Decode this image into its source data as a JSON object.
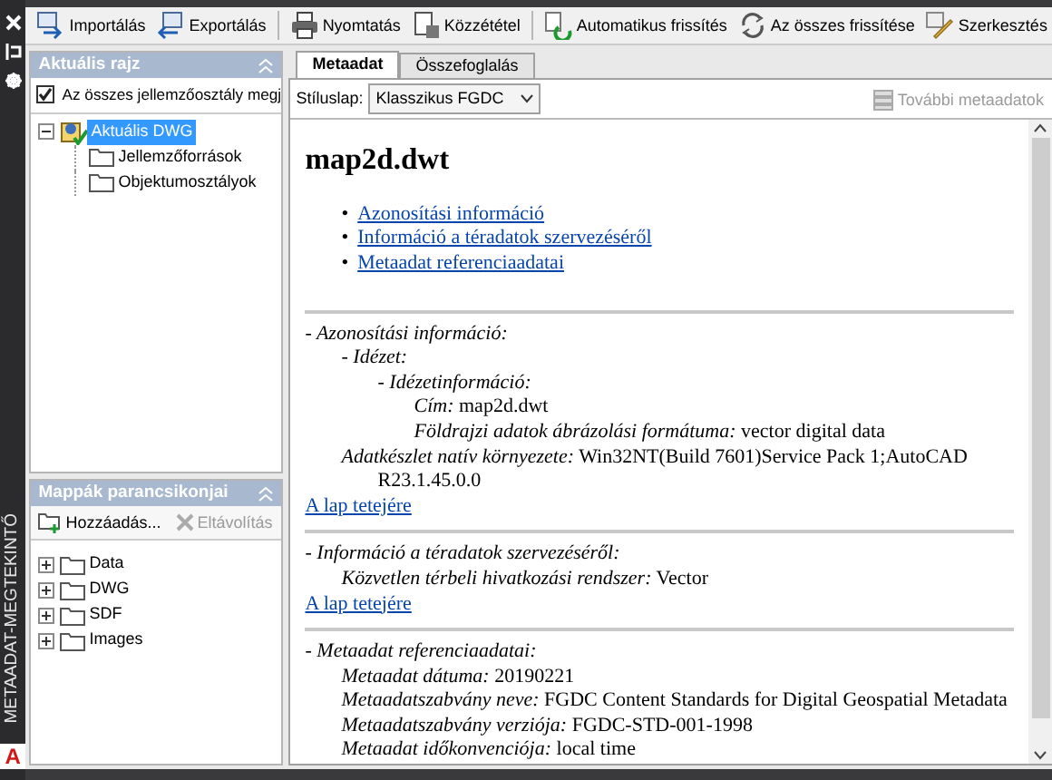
{
  "side_strip": {
    "title": "METAADAT-MEGTEKINTŐ",
    "logo": "A"
  },
  "toolbar": [
    [
      {
        "label": "Importálás"
      },
      {
        "label": "Exportálás"
      }
    ],
    [
      {
        "label": "Nyomtatás"
      },
      {
        "label": "Közzététel"
      }
    ],
    [
      {
        "label": "Automatikus frissítés"
      },
      {
        "label": "Az összes frissítése"
      },
      {
        "label": "Szerkesztés"
      }
    ]
  ],
  "drawing_panel": {
    "title": "Aktuális rajz",
    "checkbox": {
      "label": "Az összes jellemzőosztály megj",
      "checked": true
    },
    "tree": [
      {
        "label": "Aktuális DWG",
        "expanded": true,
        "selected": true,
        "children": [
          {
            "label": "Jellemzőforrások",
            "selected": false
          },
          {
            "label": "Objektumosztályok",
            "selected": false
          }
        ]
      }
    ]
  },
  "folders_panel": {
    "title": "Mappák parancsikonjai",
    "actions": [
      {
        "label": "Hozzáadás...",
        "disabled": false
      },
      {
        "label": "Eltávolítás",
        "disabled": true
      }
    ],
    "tree": [
      {
        "label": "Data",
        "expanded": false,
        "selected": false
      },
      {
        "label": "DWG",
        "expanded": false,
        "selected": false
      },
      {
        "label": "SDF",
        "expanded": false,
        "selected": false
      },
      {
        "label": "Images",
        "expanded": false,
        "selected": false
      }
    ]
  },
  "tabs": [
    {
      "label": "Metaadat",
      "selected": true
    },
    {
      "label": "Összefoglalás",
      "selected": false
    }
  ],
  "stylesheet": {
    "label": "Stíluslap:",
    "value": "Klasszikus FGDC"
  },
  "more_metadata": {
    "label": "További metaadatok",
    "disabled": true
  },
  "document": {
    "title": "map2d.dwt",
    "toc": [
      {
        "bullet": "•",
        "label": "Azonosítási információ"
      },
      {
        "bullet": "•",
        "label": "Információ a téradatok szervezéséről"
      },
      {
        "bullet": "•",
        "label": "Metaadat referenciaadatai"
      }
    ],
    "sections": [
      {
        "heading": "- Azonosítási információ:",
        "back_link": "A lap tetejére",
        "entries": [
          {
            "label": "- Idézet:",
            "children": [
              {
                "label": "- Idézetinformáció:",
                "children": [
                  {
                    "label": "Cím:",
                    "value": "map2d.dwt"
                  },
                  {
                    "label": "Földrajzi adatok ábrázolási formátuma:",
                    "value": "vector digital data"
                  }
                ]
              }
            ]
          },
          {
            "label": "Adatkészlet natív környezete:",
            "value": "Win32NT(Build 7601)Service Pack 1;AutoCAD R23.1.45.0.0"
          }
        ]
      },
      {
        "heading": "- Információ a téradatok szervezéséről:",
        "back_link": "A lap tetejére",
        "entries": [
          {
            "label": "Közvetlen térbeli hivatkozási rendszer:",
            "value": "Vector"
          }
        ]
      },
      {
        "heading": "- Metaadat referenciaadatai:",
        "entries": [
          {
            "label": "Metaadat dátuma:",
            "value": "20190221"
          },
          {
            "label": "Metaadatszabvány neve:",
            "value": "FGDC Content Standards for Digital Geospatial Metadata"
          },
          {
            "label": "Metaadatszabvány verziója:",
            "value": "FGDC-STD-001-1998"
          },
          {
            "label": "Metaadat időkonvenciója:",
            "value": "local time"
          }
        ]
      }
    ]
  }
}
